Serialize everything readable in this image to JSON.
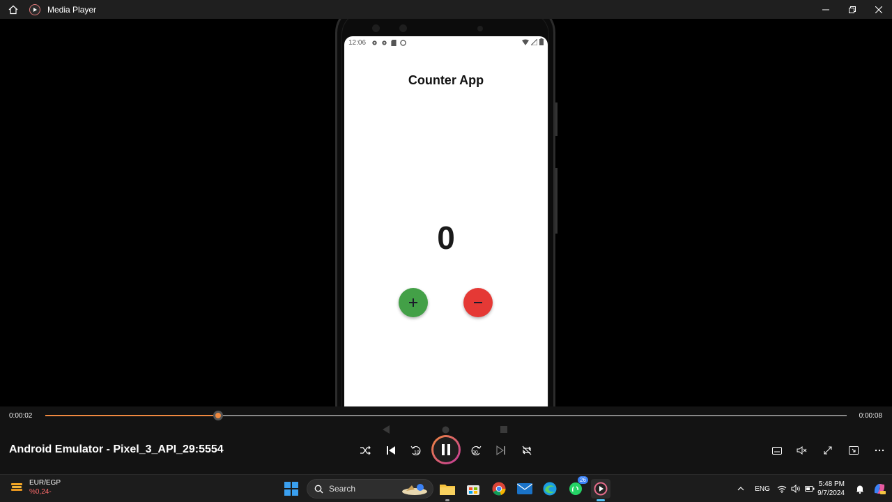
{
  "window": {
    "title": "Media Player",
    "controls": [
      "minimize",
      "maximize",
      "close"
    ]
  },
  "phone": {
    "status_time": "12:06",
    "app_title": "Counter App",
    "counter_value": "0",
    "increment_color": "#43a047",
    "decrement_color": "#e53935"
  },
  "player": {
    "current_time": "0:00:02",
    "total_time": "0:00:08",
    "progress": 0.216,
    "media_title": "Android Emulator - Pixel_3_API_29:5554",
    "rewind_label": "10",
    "forward_label": "30",
    "accent_color": "#f08a40"
  },
  "taskbar": {
    "weather_title": "EUR/EGP",
    "weather_value": "%0,24-",
    "search_placeholder": "Search",
    "language": "ENG",
    "time": "5:48 PM",
    "date": "9/7/2024",
    "whatsapp_badge": "26"
  }
}
